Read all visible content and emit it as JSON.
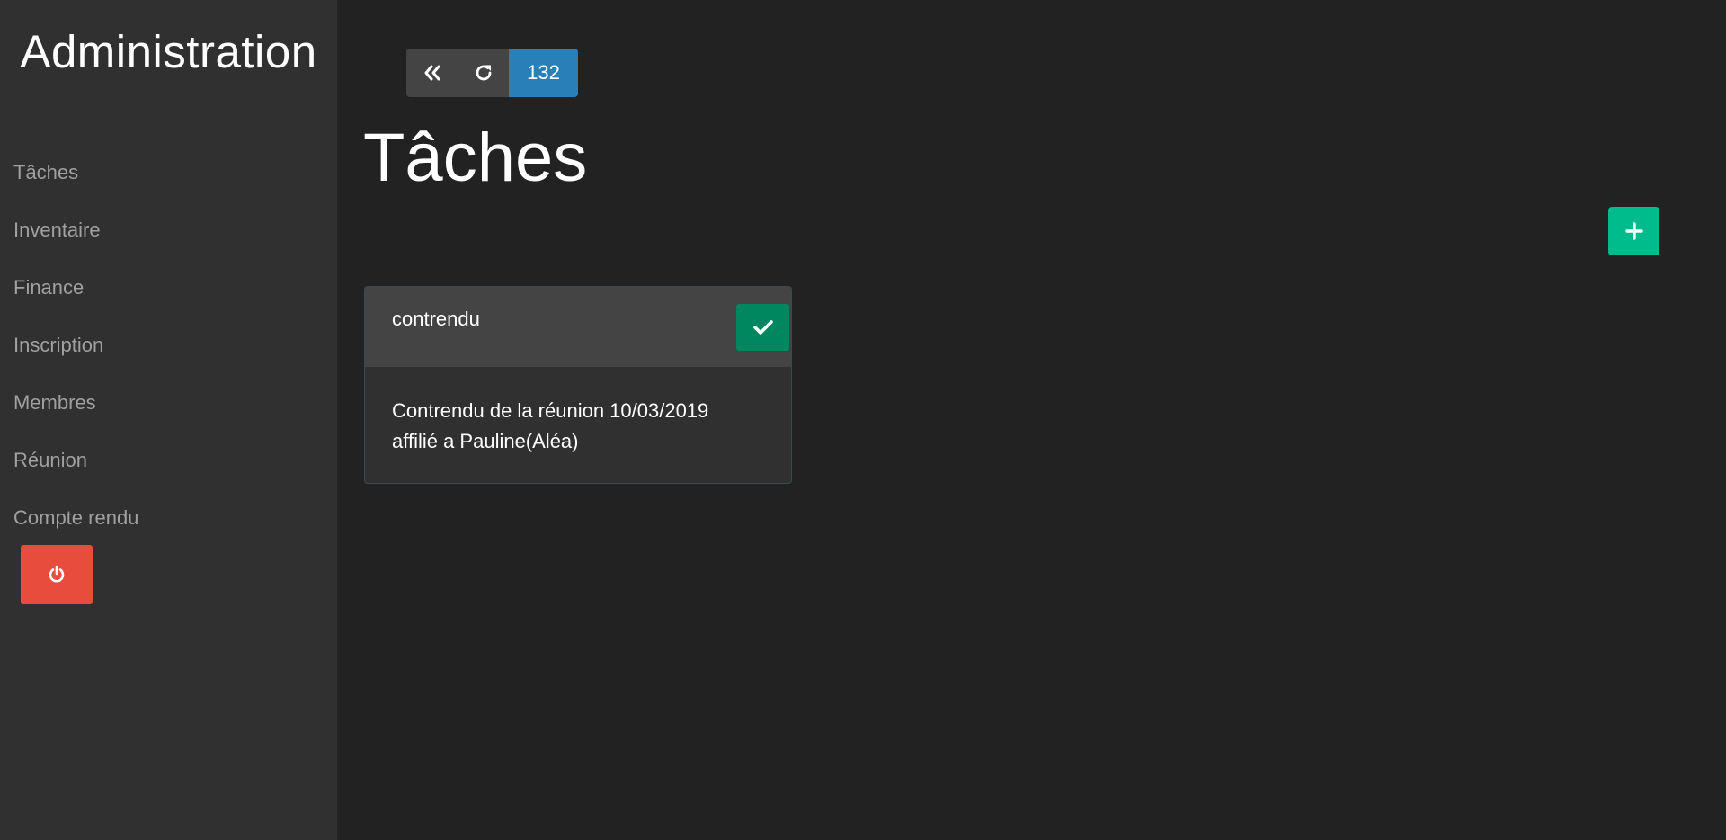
{
  "brand": "Administration",
  "nav": {
    "items": [
      {
        "label": "Tâches"
      },
      {
        "label": "Inventaire"
      },
      {
        "label": "Finance"
      },
      {
        "label": "Inscription"
      },
      {
        "label": "Membres"
      },
      {
        "label": "Réunion"
      },
      {
        "label": "Compte rendu"
      }
    ]
  },
  "logout": {
    "icon": "power-icon",
    "color": "#e74c3c"
  },
  "toolbar": {
    "back_icon": "double-chevron-left-icon",
    "refresh_icon": "refresh-icon",
    "count": "132",
    "count_color": "#2980b9"
  },
  "page": {
    "title": "Tâches"
  },
  "add_button": {
    "icon": "plus-icon",
    "color": "#00bc8c"
  },
  "tasks": [
    {
      "title": "contrendu",
      "description": "Contrendu de la réunion 10/03/2019",
      "assignee": "affilié a Pauline(Aléa)",
      "done_icon": "check-icon"
    }
  ]
}
